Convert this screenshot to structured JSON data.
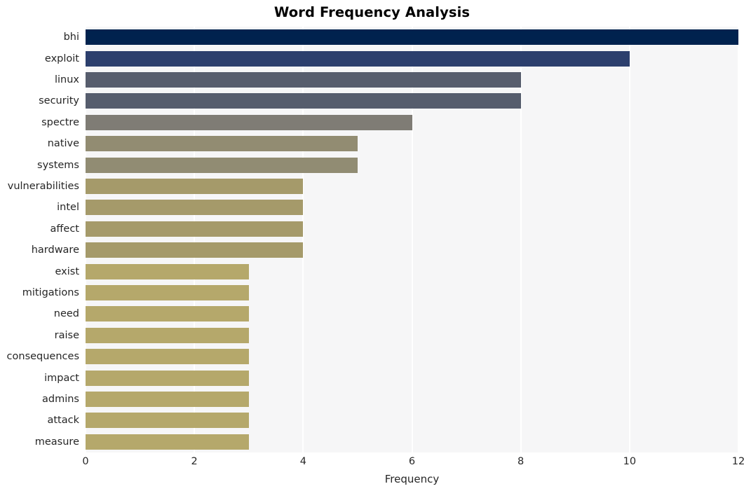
{
  "chart_data": {
    "type": "bar",
    "orientation": "horizontal",
    "title": "Word Frequency Analysis",
    "xlabel": "Frequency",
    "ylabel": "",
    "xlim": [
      0,
      12
    ],
    "xticks": [
      0,
      2,
      4,
      6,
      8,
      10,
      12
    ],
    "xtick_labels": [
      "0",
      "2",
      "4",
      "6",
      "8",
      "10",
      "12"
    ],
    "grid": true,
    "legend": null,
    "categories": [
      "bhi",
      "exploit",
      "linux",
      "security",
      "spectre",
      "native",
      "systems",
      "vulnerabilities",
      "intel",
      "affect",
      "hardware",
      "exist",
      "mitigations",
      "need",
      "raise",
      "consequences",
      "impact",
      "admins",
      "attack",
      "measure"
    ],
    "values": [
      12,
      10,
      8,
      8,
      6,
      5,
      5,
      4,
      4,
      4,
      4,
      3,
      3,
      3,
      3,
      3,
      3,
      3,
      3,
      3
    ],
    "colors": [
      "#00224e",
      "#2c3f6d",
      "#575d6d",
      "#565d6d",
      "#7f7c75",
      "#928c72",
      "#918c73",
      "#a59a6a",
      "#a59a6a",
      "#a59a6a",
      "#a59a6a",
      "#b5a86b",
      "#b5a86b",
      "#b5a86b",
      "#b5a86b",
      "#b5a86b",
      "#b5a86b",
      "#b5a86b",
      "#b5a86b",
      "#b5a86b"
    ],
    "palette_name": "cividis",
    "plot_background": "#f6f6f7",
    "gridline_color": "#ffffff",
    "figure_background": "#ffffff"
  }
}
